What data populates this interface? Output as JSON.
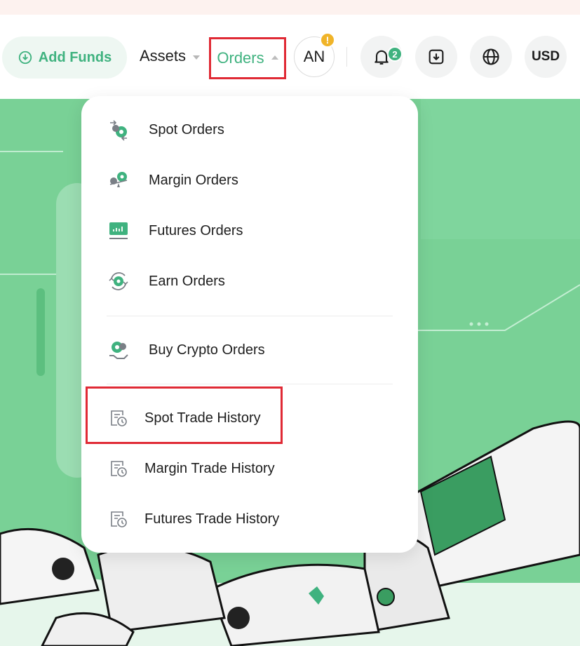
{
  "header": {
    "add_funds_label": "Add Funds",
    "nav": {
      "assets_label": "Assets",
      "orders_label": "Orders"
    },
    "avatar_initials": "AN",
    "avatar_badge": "!",
    "notification_count": "2",
    "currency": "USD"
  },
  "orders_menu": {
    "items": [
      {
        "label": "Spot Orders",
        "icon": "spot-orders-icon"
      },
      {
        "label": "Margin Orders",
        "icon": "margin-orders-icon"
      },
      {
        "label": "Futures Orders",
        "icon": "futures-orders-icon"
      },
      {
        "label": "Earn Orders",
        "icon": "earn-orders-icon"
      },
      {
        "label": "Buy Crypto Orders",
        "icon": "buy-crypto-orders-icon"
      },
      {
        "label": "Spot Trade History",
        "icon": "history-icon"
      },
      {
        "label": "Margin Trade History",
        "icon": "history-icon"
      },
      {
        "label": "Futures Trade History",
        "icon": "history-icon"
      }
    ]
  },
  "colors": {
    "brand_green": "#3fb27f",
    "hero_green": "#79d196",
    "highlight_red": "#e02a35",
    "warning_badge": "#f0b429"
  }
}
